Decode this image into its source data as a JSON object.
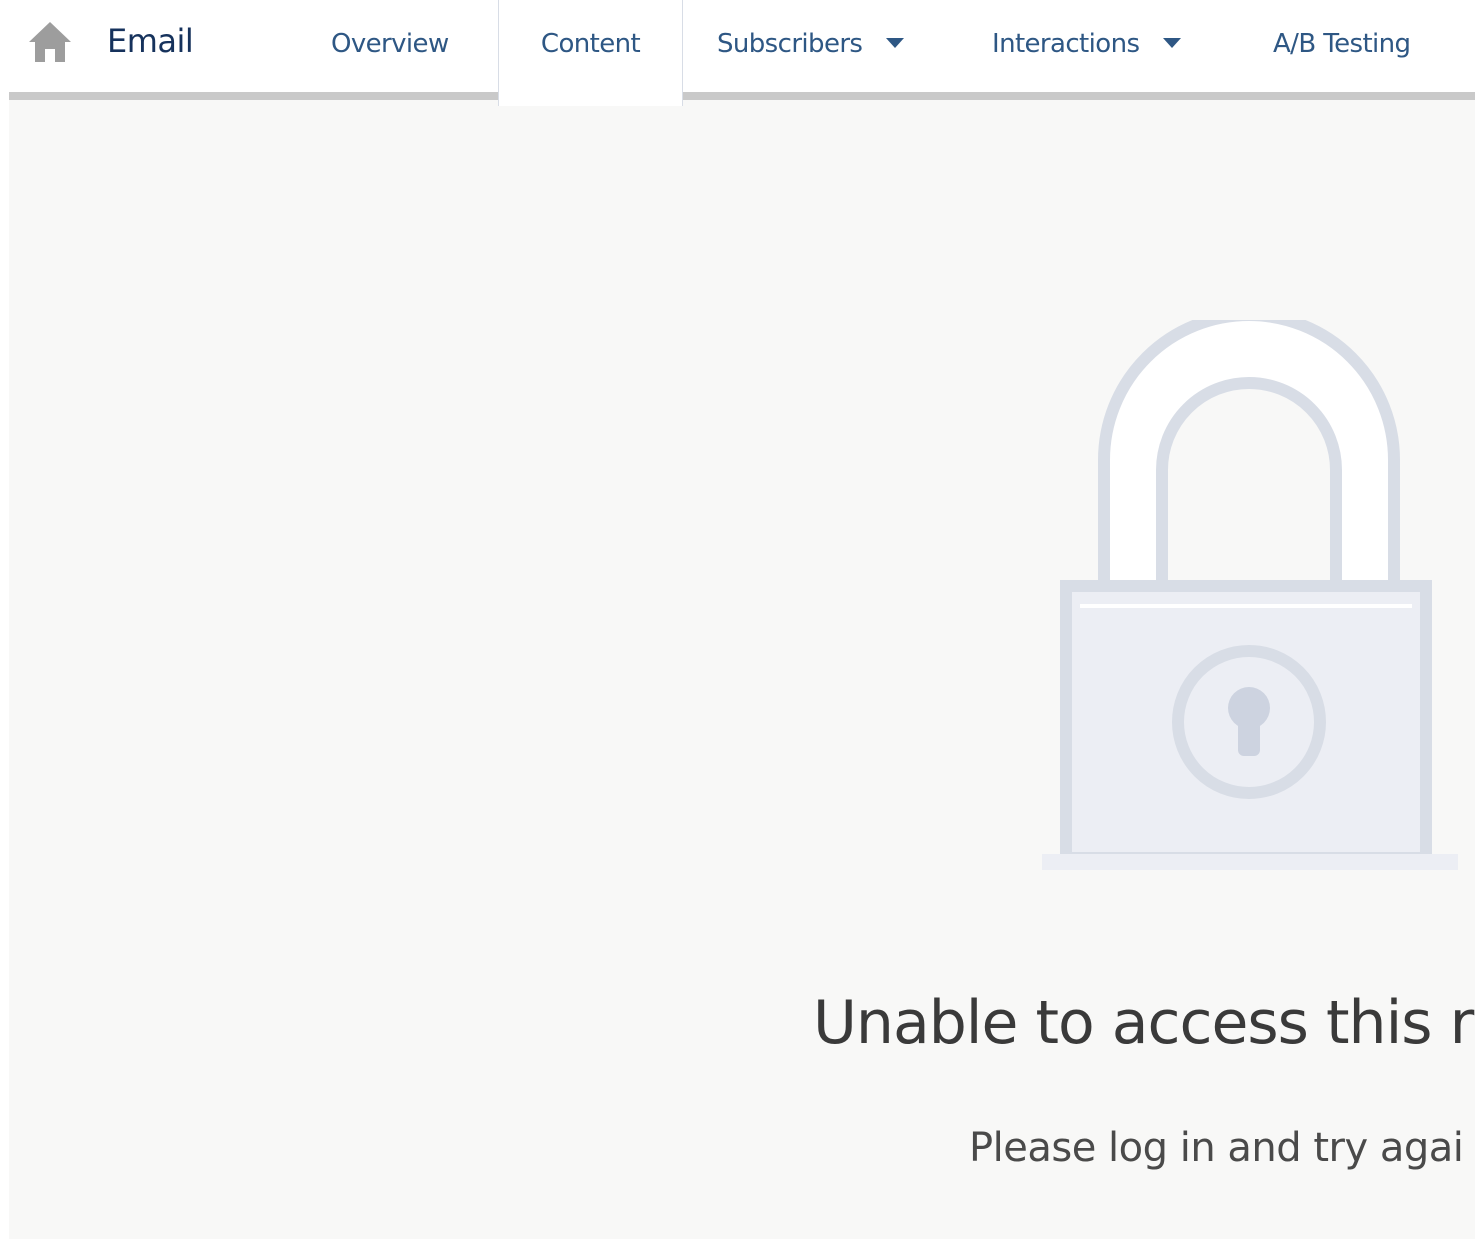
{
  "header": {
    "app_name": "Email",
    "home_icon": "home-icon",
    "tabs": [
      {
        "label": "Overview",
        "active": false,
        "has_menu": false
      },
      {
        "label": "Content",
        "active": true,
        "has_menu": false
      },
      {
        "label": "Subscribers",
        "active": false,
        "has_menu": true
      },
      {
        "label": "Interactions",
        "active": false,
        "has_menu": true
      },
      {
        "label": "A/B Testing",
        "active": false,
        "has_menu": false
      }
    ]
  },
  "main": {
    "illustration_icon": "lock-icon",
    "title": "Unable to access this re",
    "subtitle": "Please log in and try agai"
  },
  "colors": {
    "nav_text": "#2e5784",
    "app_name": "#16325c",
    "page_background": "#f8f8f7",
    "illustration": "#d8dde6",
    "tab_underline": "#c9c9c9"
  }
}
